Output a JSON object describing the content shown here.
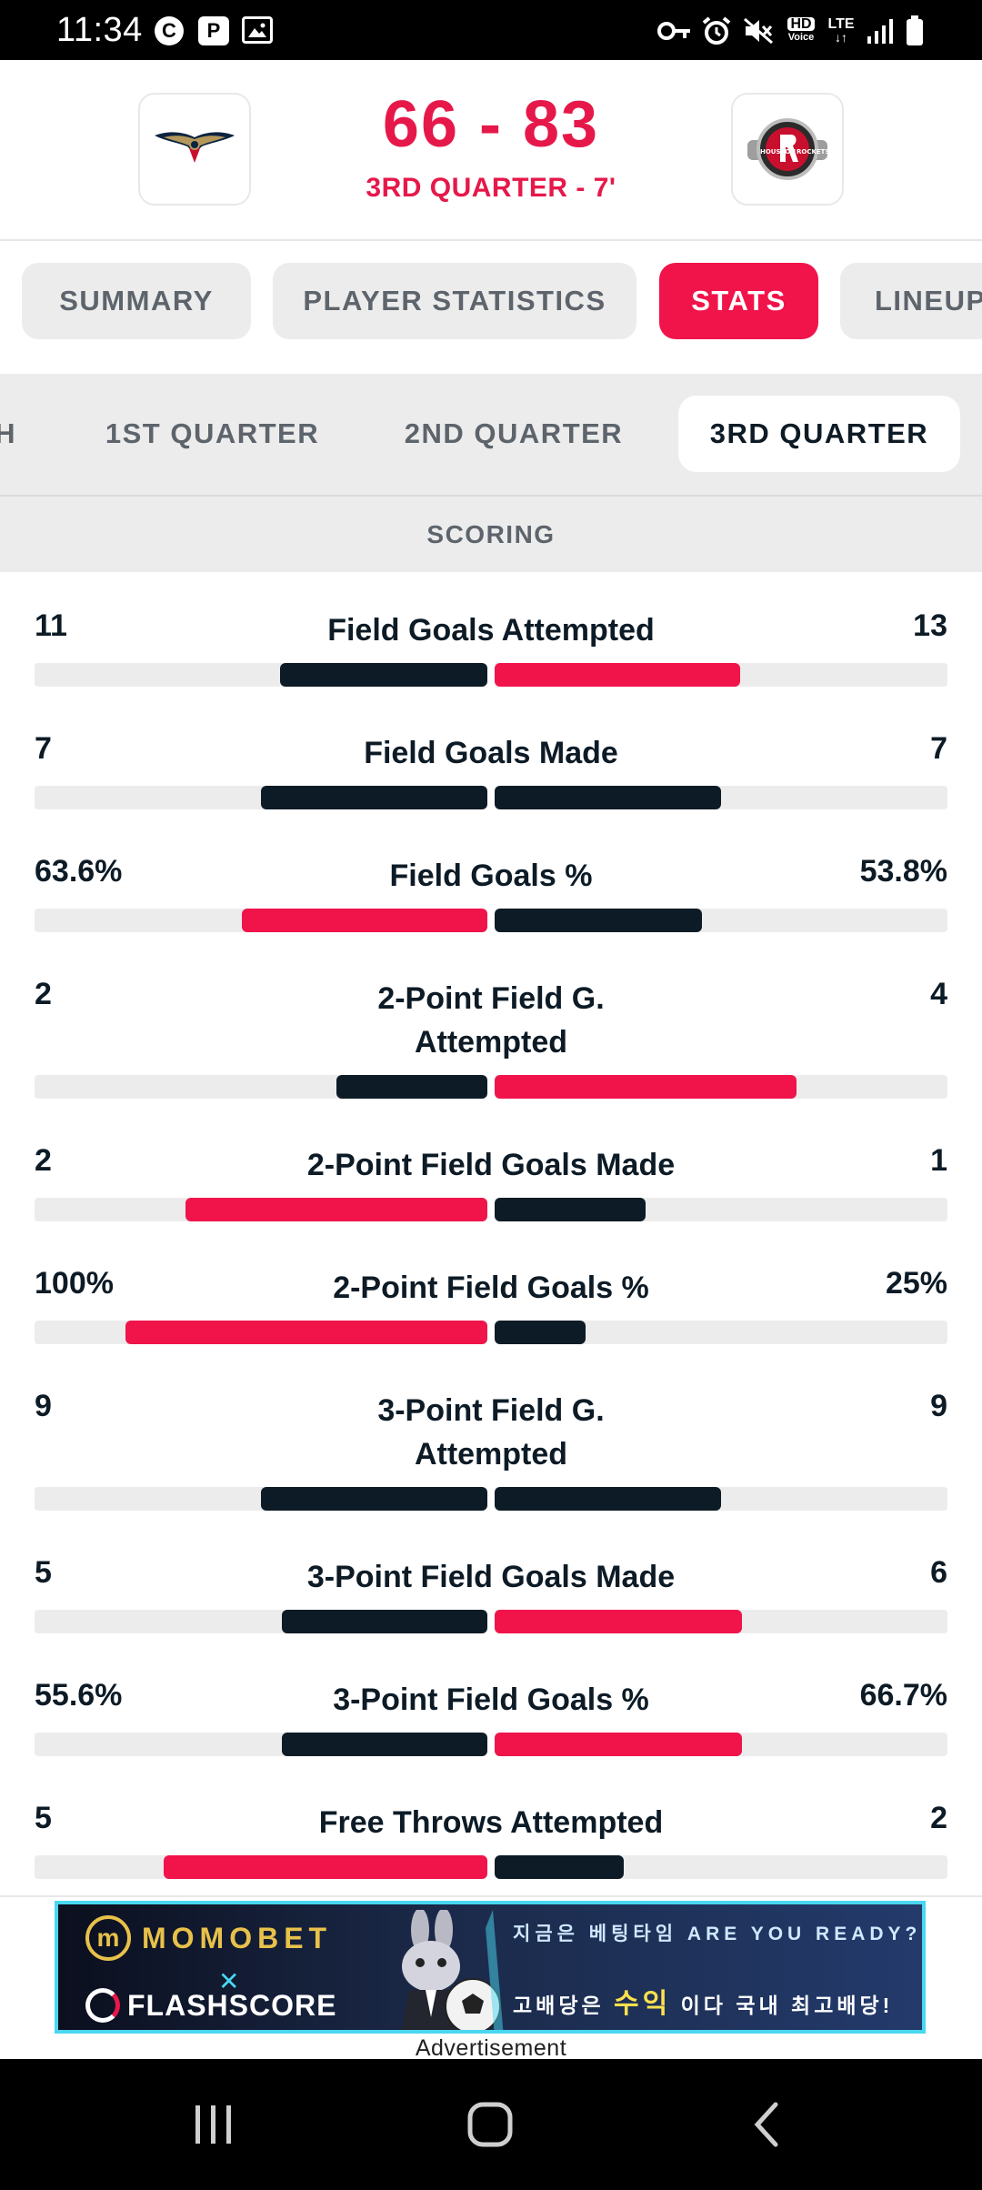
{
  "status_bar": {
    "time": "11:34",
    "icons": [
      "c-circle-icon",
      "parking-icon",
      "image-icon",
      "key-icon",
      "alarm-icon",
      "mute-icon",
      "hd-voice-icon",
      "lte-icon",
      "signal-icon",
      "battery-icon"
    ],
    "hd_label": "HD",
    "voice_label": "Voice",
    "lte_label": "LTE"
  },
  "match": {
    "home_logo": "pelicans-logo-icon",
    "away_logo": "rockets-logo-icon",
    "score": "66 - 83",
    "period": "3RD QUARTER - 7'",
    "accent_color": "#e6184a"
  },
  "tabs": [
    {
      "label": "SUMMARY",
      "active": false
    },
    {
      "label": "PLAYER STATISTICS",
      "active": false
    },
    {
      "label": "STATS",
      "active": true
    },
    {
      "label": "LINEUPS",
      "active": false
    }
  ],
  "quarter_tabs": [
    {
      "label": "MATCH",
      "active": false
    },
    {
      "label": "1ST QUARTER",
      "active": false
    },
    {
      "label": "2ND QUARTER",
      "active": false
    },
    {
      "label": "3RD QUARTER",
      "active": true
    }
  ],
  "section_title": "SCORING",
  "colors": {
    "winner": "#f0144a",
    "other": "#0d1b26",
    "track": "#ececec"
  },
  "stats": [
    {
      "label": "Field Goals Attempted",
      "home": "11",
      "away": "13",
      "home_value": 11,
      "away_value": 13,
      "home_color": "#0d1b26",
      "away_color": "#f0144a"
    },
    {
      "label": "Field Goals Made",
      "home": "7",
      "away": "7",
      "home_value": 7,
      "away_value": 7,
      "home_color": "#0d1b26",
      "away_color": "#0d1b26"
    },
    {
      "label": "Field Goals %",
      "home": "63.6%",
      "away": "53.8%",
      "home_value": 63.6,
      "away_value": 53.8,
      "home_color": "#f0144a",
      "away_color": "#0d1b26"
    },
    {
      "label": "2-Point Field G. Attempted",
      "home": "2",
      "away": "4",
      "home_value": 2,
      "away_value": 4,
      "home_color": "#0d1b26",
      "away_color": "#f0144a"
    },
    {
      "label": "2-Point Field Goals Made",
      "home": "2",
      "away": "1",
      "home_value": 2,
      "away_value": 1,
      "home_color": "#f0144a",
      "away_color": "#0d1b26"
    },
    {
      "label": "2-Point Field Goals %",
      "home": "100%",
      "away": "25%",
      "home_value": 100,
      "away_value": 25,
      "home_color": "#f0144a",
      "away_color": "#0d1b26"
    },
    {
      "label": "3-Point Field G. Attempted",
      "home": "9",
      "away": "9",
      "home_value": 9,
      "away_value": 9,
      "home_color": "#0d1b26",
      "away_color": "#0d1b26"
    },
    {
      "label": "3-Point Field Goals Made",
      "home": "5",
      "away": "6",
      "home_value": 5,
      "away_value": 6,
      "home_color": "#0d1b26",
      "away_color": "#f0144a"
    },
    {
      "label": "3-Point Field Goals %",
      "home": "55.6%",
      "away": "66.7%",
      "home_value": 55.6,
      "away_value": 66.7,
      "home_color": "#0d1b26",
      "away_color": "#f0144a"
    },
    {
      "label": "Free Throws Attempted",
      "home": "5",
      "away": "2",
      "home_value": 5,
      "away_value": 2,
      "home_color": "#f0144a",
      "away_color": "#0d1b26"
    }
  ],
  "ad": {
    "brand1": "MOMOBET",
    "brand1_mark": "m",
    "x_mark": "✕",
    "brand2": "FLASHSCORE",
    "line1": "지금은 베팅타임 ARE YOU READY?",
    "line2_prefix": "고배당은",
    "line2_highlight": "수익",
    "line2_suffix": "이다 국내 최고배당!",
    "label": "Advertisement"
  },
  "nav": {
    "recents": "recents-icon",
    "home": "home-icon",
    "back": "back-icon"
  }
}
